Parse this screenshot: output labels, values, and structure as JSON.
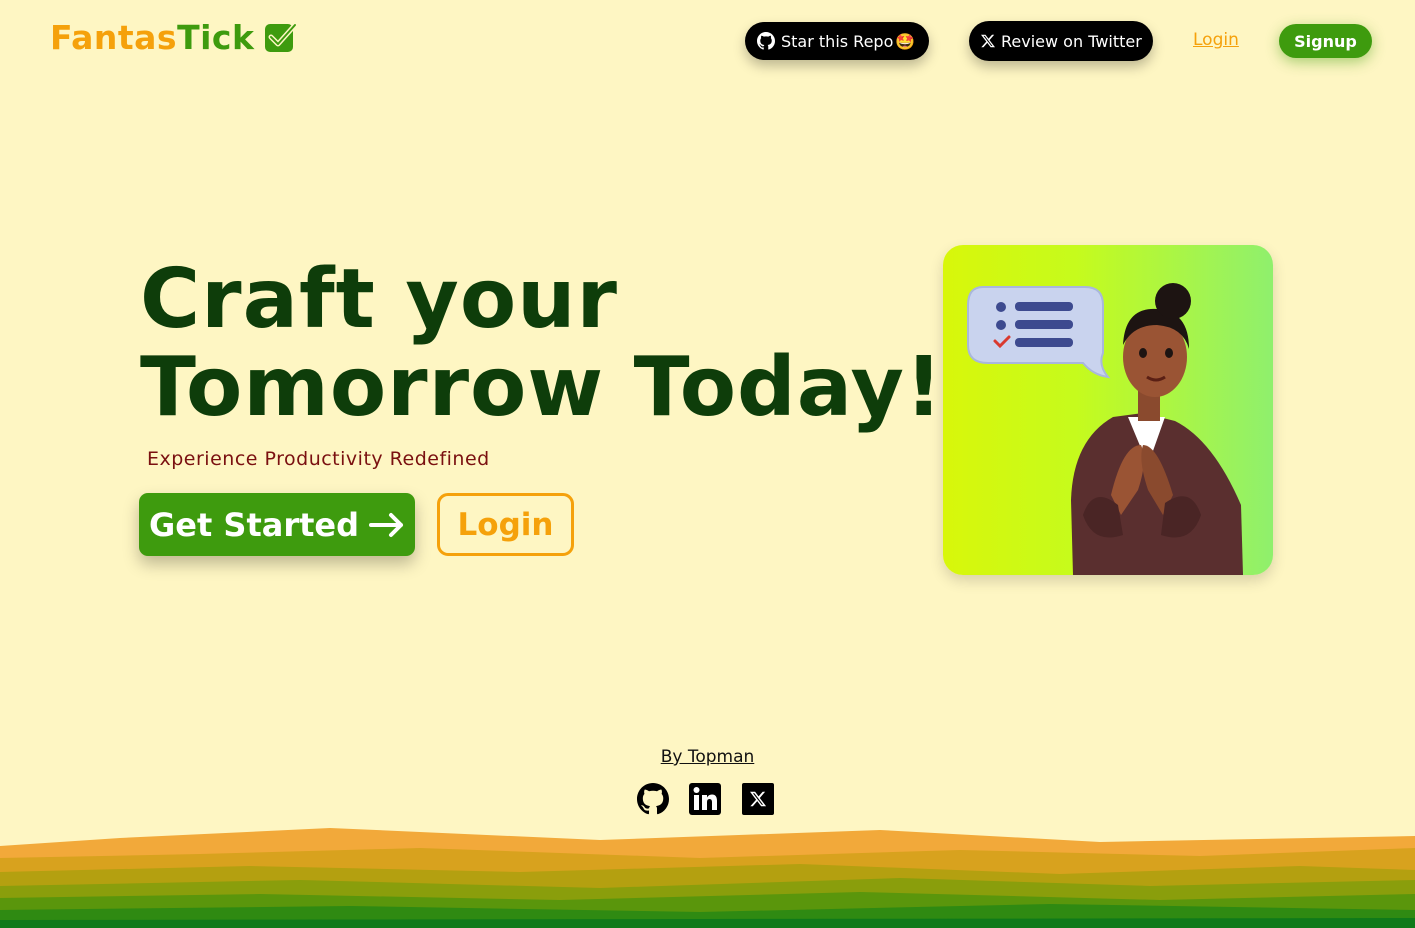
{
  "header": {
    "logo_part1": "Fantas",
    "logo_part2": "Tick",
    "star_repo_label": "Star this Repo",
    "star_repo_emoji": "🤩",
    "review_label": "Review on Twitter",
    "login_label": "Login",
    "signup_label": "Signup"
  },
  "hero": {
    "title_line1": "Craft your",
    "title_line2": "Tomorrow Today!",
    "subtitle": "Experience Productivity Redefined",
    "get_started_label": "Get Started",
    "login_label": "Login"
  },
  "footer": {
    "byline": "By Topman",
    "social_icons": [
      "github-icon",
      "linkedin-icon",
      "x-icon"
    ]
  },
  "colors": {
    "background": "#fef6c3",
    "brand_orange": "#f5a10b",
    "brand_green": "#3e9b0e",
    "title_green": "#0e3d0a",
    "subtitle_red": "#7a1010"
  }
}
